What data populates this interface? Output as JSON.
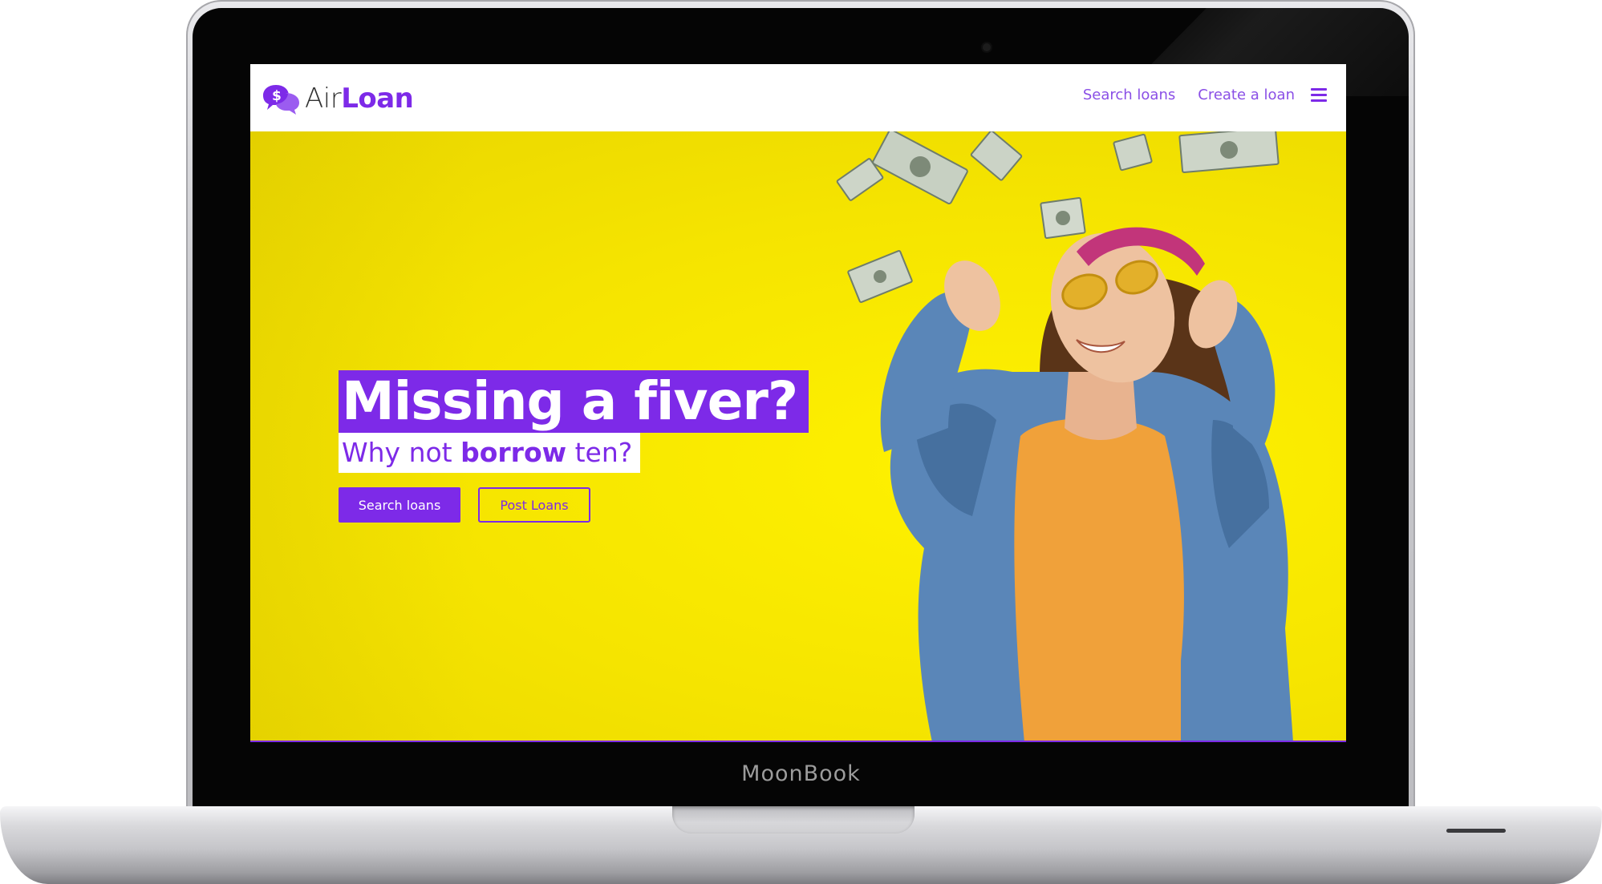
{
  "device": {
    "brand_label": "MoonBook"
  },
  "navbar": {
    "logo_prefix": "Air",
    "logo_suffix": "Loan",
    "links": [
      {
        "label": "Search loans"
      },
      {
        "label": "Create a loan"
      }
    ],
    "menu_icon": "hamburger-menu-icon"
  },
  "hero": {
    "headline": "Missing a fiver?",
    "sub_prefix": "Why not ",
    "sub_bold": "borrow",
    "sub_suffix": " ten?",
    "primary_button": "Search loans",
    "secondary_button": "Post Loans"
  },
  "colors": {
    "accent": "#7d2ae8",
    "hero_background": "#f5e400",
    "nav_background": "#ffffff"
  },
  "icons": {
    "logo": "chat-bubble-dollar-icon"
  }
}
